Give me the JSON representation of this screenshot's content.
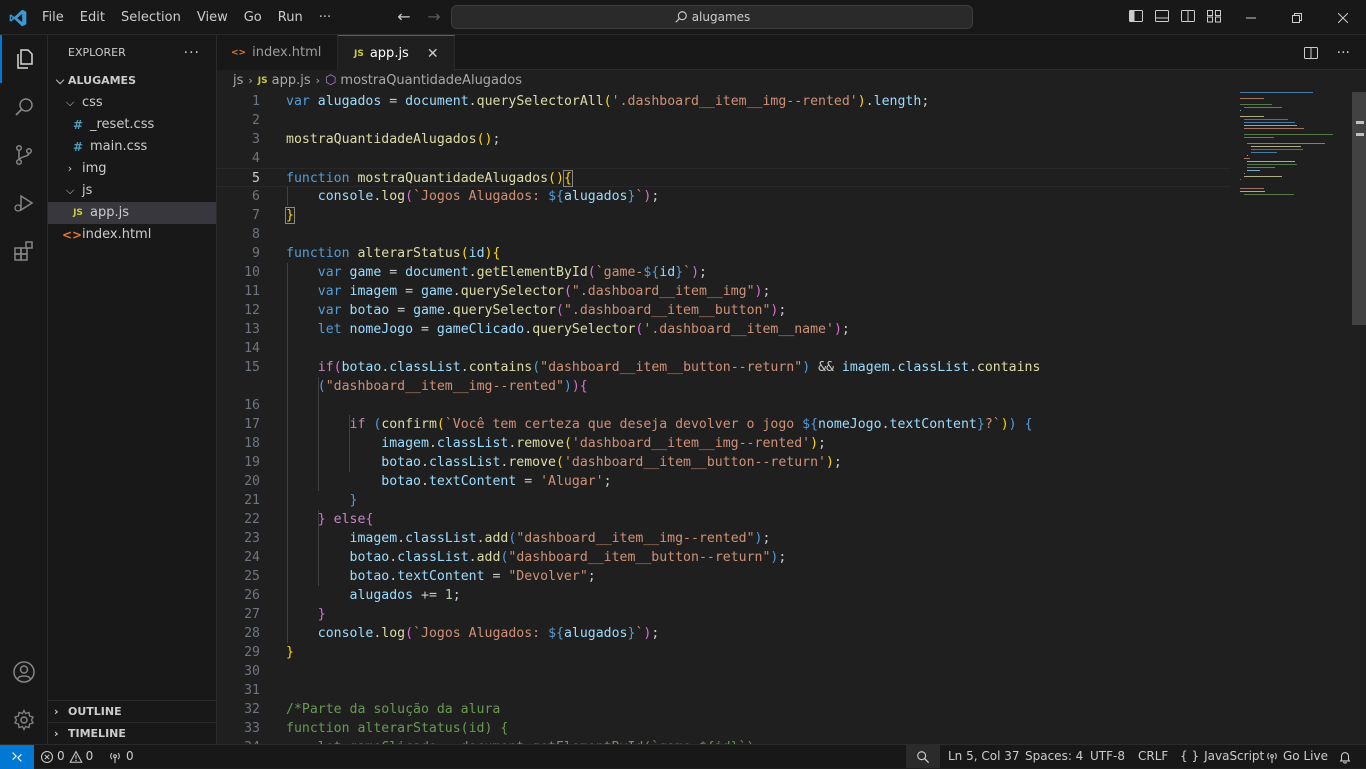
{
  "titlebar": {
    "menu": [
      "File",
      "Edit",
      "Selection",
      "View",
      "Go",
      "Run",
      "···"
    ],
    "search_text": "alugames"
  },
  "sidebar": {
    "title": "EXPLORER",
    "root": "ALUGAMES",
    "tree": [
      {
        "type": "folder",
        "name": "css",
        "expanded": true,
        "depth": 1
      },
      {
        "type": "file",
        "name": "_reset.css",
        "icon": "#",
        "kind": "css",
        "depth": 2
      },
      {
        "type": "file",
        "name": "main.css",
        "icon": "#",
        "kind": "css",
        "depth": 2
      },
      {
        "type": "folder",
        "name": "img",
        "expanded": false,
        "depth": 1
      },
      {
        "type": "folder",
        "name": "js",
        "expanded": true,
        "depth": 1
      },
      {
        "type": "file",
        "name": "app.js",
        "icon": "JS",
        "kind": "js",
        "depth": 2,
        "selected": true
      },
      {
        "type": "file",
        "name": "index.html",
        "icon": "<>",
        "kind": "html",
        "depth": 1
      }
    ],
    "outline": "OUTLINE",
    "timeline": "TIMELINE"
  },
  "tabs": [
    {
      "label": "index.html",
      "icon": "<>",
      "active": false
    },
    {
      "label": "app.js",
      "icon": "JS",
      "active": true
    }
  ],
  "breadcrumb": {
    "folder": "js",
    "file": "app.js",
    "symbol": "mostraQuantidadeAlugados"
  },
  "editor": {
    "current_line": 5,
    "lines": [
      {
        "n": "1",
        "html": "<span class='k'>var</span> <span class='v'>alugados</span> = <span class='v'>document</span>.<span class='f'>querySelectorAll</span><span class='y'>(</span><span class='s'>'.dashboard__item__img--rented'</span><span class='y'>)</span>.<span class='v'>length</span>;"
      },
      {
        "n": "2",
        "html": ""
      },
      {
        "n": "3",
        "html": "<span class='f'>mostraQuantidadeAlugados</span><span class='y'>()</span>;"
      },
      {
        "n": "4",
        "html": ""
      },
      {
        "n": "5",
        "html": "<span class='k'>function</span> <span class='f'>mostraQuantidadeAlugados</span><span class='y'>()</span><span class='y bo'>{</span>"
      },
      {
        "n": "6",
        "html": "    <span class='v'>console</span>.<span class='f'>log</span><span class='m'>(</span><span class='s'>`Jogos Alugados: </span><span class='k'>${</span><span class='v'>alugados</span><span class='k'>}</span><span class='s'>`</span><span class='m'>)</span>;"
      },
      {
        "n": "7",
        "html": "<span class='y bo'>}</span>"
      },
      {
        "n": "8",
        "html": ""
      },
      {
        "n": "9",
        "html": "<span class='k'>function</span> <span class='f'>alterarStatus</span><span class='y'>(</span><span class='v'>id</span><span class='y'>){</span>"
      },
      {
        "n": "10",
        "html": "    <span class='k'>var</span> <span class='v'>game</span> = <span class='v'>document</span>.<span class='f'>getElementById</span><span class='m'>(</span><span class='s'>`game-</span><span class='k'>${</span><span class='v'>id</span><span class='k'>}</span><span class='s'>`</span><span class='m'>)</span>;"
      },
      {
        "n": "11",
        "html": "    <span class='k'>var</span> <span class='v'>imagem</span> = <span class='v'>game</span>.<span class='f'>querySelector</span><span class='m'>(</span><span class='s'>\".dashboard__item__img\"</span><span class='m'>)</span>;"
      },
      {
        "n": "12",
        "html": "    <span class='k'>var</span> <span class='v'>botao</span> = <span class='v'>game</span>.<span class='f'>querySelector</span><span class='m'>(</span><span class='s'>\".dashboard__item__button\"</span><span class='m'>)</span>;"
      },
      {
        "n": "13",
        "html": "    <span class='k'>let</span> <span class='v'>nomeJogo</span> = <span class='v'>gameClicado</span>.<span class='f'>querySelector</span><span class='m'>(</span><span class='s'>'.dashboard__item__name'</span><span class='m'>)</span>;"
      },
      {
        "n": "14",
        "html": ""
      },
      {
        "n": "15",
        "html": "    <span class='kw2'>if</span><span class='m'>(</span><span class='v'>botao</span>.<span class='v'>classList</span>.<span class='f'>contains</span><span class='tp'>(</span><span class='s'>\"dashboard__item__button--return\"</span><span class='tp'>)</span> &amp;&amp; <span class='v'>imagem</span>.<span class='v'>classList</span>.<span class='f'>contains</span>"
      },
      {
        "n": "",
        "html": "    <span class='tp'>(</span><span class='s'>\"dashboard__item__img--rented\"</span><span class='tp'>)</span><span class='m'>){</span>"
      },
      {
        "n": "16",
        "html": ""
      },
      {
        "n": "17",
        "html": "        <span class='kw2'>if</span> <span class='tp'>(</span><span class='f'>confirm</span><span class='y'>(</span><span class='s'>`Você tem certeza que deseja devolver o jogo </span><span class='k'>${</span><span class='v'>nomeJogo</span>.<span class='v'>textContent</span><span class='k'>}</span><span class='s'>?`</span><span class='y'>)</span><span class='tp'>)</span> <span class='tp'>{</span>"
      },
      {
        "n": "18",
        "html": "            <span class='v'>imagem</span>.<span class='v'>classList</span>.<span class='f'>remove</span><span class='y'>(</span><span class='s'>'dashboard__item__img--rented'</span><span class='y'>)</span>;"
      },
      {
        "n": "19",
        "html": "            <span class='v'>botao</span>.<span class='v'>classList</span>.<span class='f'>remove</span><span class='y'>(</span><span class='s'>'dashboard__item__button--return'</span><span class='y'>)</span>;"
      },
      {
        "n": "20",
        "html": "            <span class='v'>botao</span>.<span class='v'>textContent</span> = <span class='s'>'Alugar'</span>;"
      },
      {
        "n": "21",
        "html": "        <span class='tp'>}</span>"
      },
      {
        "n": "22",
        "html": "    <span class='m'>}</span> <span class='kw2'>else</span><span class='m'>{</span>"
      },
      {
        "n": "23",
        "html": "        <span class='v'>imagem</span>.<span class='v'>classList</span>.<span class='f'>add</span><span class='tp'>(</span><span class='s'>\"dashboard__item__img--rented\"</span><span class='tp'>)</span>;"
      },
      {
        "n": "24",
        "html": "        <span class='v'>botao</span>.<span class='v'>classList</span>.<span class='f'>add</span><span class='tp'>(</span><span class='s'>\"dashboard__item__button--return\"</span><span class='tp'>)</span>;"
      },
      {
        "n": "25",
        "html": "        <span class='v'>botao</span>.<span class='v'>textContent</span> = <span class='s'>\"Devolver\"</span>;"
      },
      {
        "n": "26",
        "html": "        <span class='v'>alugados</span> += <span class='n'>1</span>;"
      },
      {
        "n": "27",
        "html": "    <span class='m'>}</span>"
      },
      {
        "n": "28",
        "html": "    <span class='v'>console</span>.<span class='f'>log</span><span class='m'>(</span><span class='s'>`Jogos Alugados: </span><span class='k'>${</span><span class='v'>alugados</span><span class='k'>}</span><span class='s'>`</span><span class='m'>)</span>;"
      },
      {
        "n": "29",
        "html": "<span class='y'>}</span>"
      },
      {
        "n": "30",
        "html": ""
      },
      {
        "n": "31",
        "html": ""
      },
      {
        "n": "32",
        "html": "<span class='c'>/*Parte da solução da alura</span>"
      },
      {
        "n": "33",
        "html": "<span class='c'>function alterarStatus(id) {</span>"
      },
      {
        "n": "34",
        "html": "<span class='c'>    let gameClicado = document.getElementById(`game-${id}`);</span>"
      }
    ]
  },
  "statusbar": {
    "errors": "0",
    "warnings": "0",
    "ports": "0",
    "position": "Ln 5, Col 37",
    "spaces": "Spaces: 4",
    "encoding": "UTF-8",
    "eol": "CRLF",
    "language": "JavaScript",
    "golive": "Go Live"
  },
  "colors": {
    "accent": "#0078d4",
    "background": "#1f1f1f",
    "sidebar": "#181818"
  }
}
